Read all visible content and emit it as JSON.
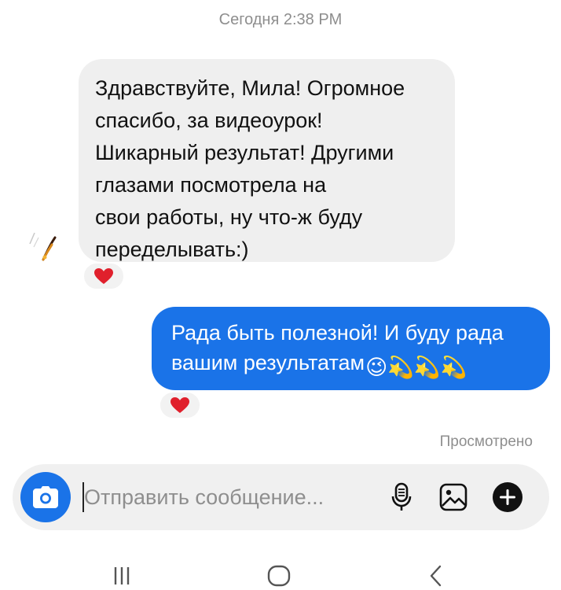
{
  "header": {
    "timestamp": "Сегодня 2:38 PM"
  },
  "messages": [
    {
      "direction": "incoming",
      "text": "Здравствуйте, Мила! Огромное\nспасибо, за видеоурок!\nШикарный результат! Другими\nглазами посмотрела на\nсвои работы, ну что-ж буду\nпеределывать:)",
      "reaction": "❤️"
    },
    {
      "direction": "outgoing",
      "text": "Рада быть полезной! И буду рада вашим результатам",
      "emojis": "😉💫💫💫",
      "reaction": "❤️"
    }
  ],
  "status": {
    "seen": "Просмотрено"
  },
  "composer": {
    "placeholder": "Отправить сообщение..."
  },
  "icons": {
    "camera": "camera-icon",
    "microphone": "microphone-icon",
    "gallery": "image-icon",
    "more": "plus-circle-icon",
    "nav_recents": "recents-icon",
    "nav_home": "home-icon",
    "nav_back": "back-icon"
  },
  "colors": {
    "accent": "#1a73e8",
    "incoming_bubble": "#efefef",
    "reaction_heart": "#e0202c",
    "meta_text": "#8e8e8e"
  }
}
